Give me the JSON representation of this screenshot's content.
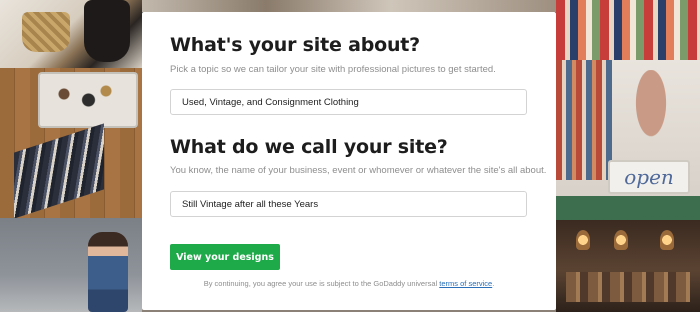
{
  "form": {
    "topic_heading": "What's your site about?",
    "topic_helper": "Pick a topic so we can tailor your site with professional pictures to get started.",
    "topic_value": "Used, Vintage, and Consignment Clothing",
    "name_heading": "What do we call your site?",
    "name_helper": "You know, the name of your business, event or whomever or whatever the site's all about.",
    "name_value": "Still Vintage after all these Years",
    "cta_label": "View your designs",
    "legal_prefix": "By continuing, you agree your use is subject to the GoDaddy universal ",
    "legal_link": "terms of service",
    "legal_suffix": "."
  },
  "background": {
    "sign_text": "open"
  },
  "colors": {
    "cta": "#1faa4a",
    "link": "#2a6fb7",
    "heading": "#1d1d1d",
    "helper": "#8e8e8e"
  }
}
